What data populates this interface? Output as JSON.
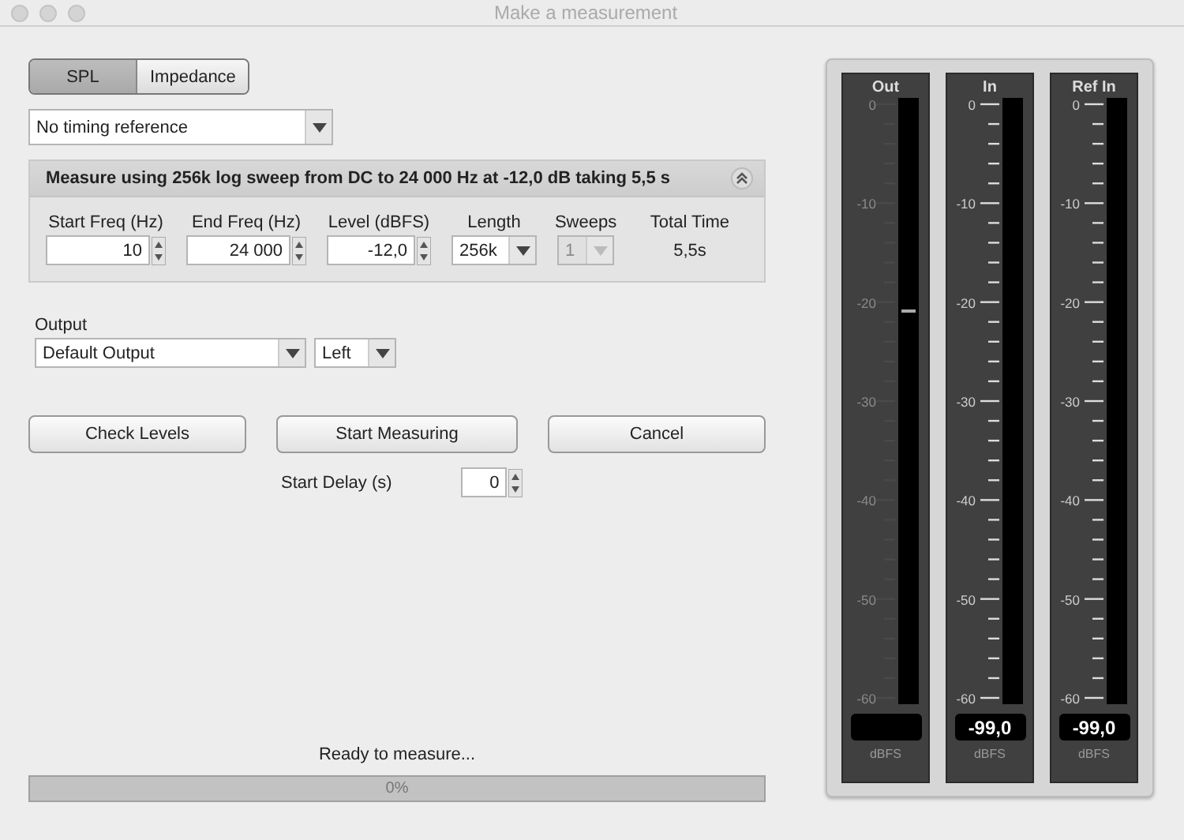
{
  "window": {
    "title": "Make a measurement"
  },
  "mode_tabs": [
    {
      "label": "SPL",
      "selected": true
    },
    {
      "label": "Impedance",
      "selected": false
    }
  ],
  "timing_reference": {
    "value": "No timing reference"
  },
  "sweep_panel": {
    "summary": "Measure using 256k log sweep from DC to 24 000 Hz at -12,0 dB taking 5,5 s",
    "expanded": true,
    "fields": [
      {
        "kind": "spinner",
        "label": "Start Freq (Hz)",
        "value": "10",
        "disabled": false
      },
      {
        "kind": "spinner",
        "label": "End Freq (Hz)",
        "value": "24 000",
        "disabled": false
      },
      {
        "kind": "spinner",
        "label": "Level (dBFS)",
        "value": "-12,0",
        "disabled": false
      },
      {
        "kind": "dropdown",
        "label": "Length",
        "value": "256k",
        "disabled": false
      },
      {
        "kind": "dropdown",
        "label": "Sweeps",
        "value": "1",
        "disabled": true
      },
      {
        "kind": "readout",
        "label": "Total Time",
        "value": "5,5s",
        "disabled": false
      }
    ]
  },
  "output": {
    "label": "Output",
    "device": "Default Output",
    "channel": "Left"
  },
  "buttons": [
    "Check Levels",
    "Start Measuring",
    "Cancel"
  ],
  "start_delay": {
    "label": "Start Delay (s)",
    "value": "0"
  },
  "status": "Ready to measure...",
  "progress": {
    "level": 0,
    "label": "0%"
  },
  "meters": {
    "channels": [
      {
        "name": "Out",
        "dim": true,
        "level": 0.65,
        "scale": [
          "0",
          "-10",
          "-20",
          "-30",
          "-40",
          "-50",
          "-60"
        ],
        "unit": "dBFS"
      },
      {
        "name": "In",
        "dim": false,
        "scale": [
          "0",
          "-10",
          "-20",
          "-30",
          "-40",
          "-50",
          "-60"
        ],
        "readout": "-99,0",
        "unit": "dBFS"
      },
      {
        "name": "Ref In",
        "dim": false,
        "scale": [
          "0",
          "-10",
          "-20",
          "-30",
          "-40",
          "-50",
          "-60"
        ],
        "readout": "-99,0",
        "unit": "dBFS"
      }
    ]
  }
}
